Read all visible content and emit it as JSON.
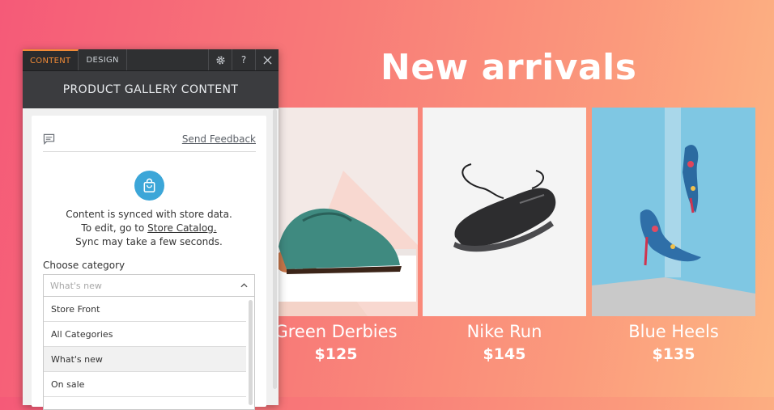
{
  "hero": {
    "title": "New arrivals"
  },
  "products": [
    {
      "name": "Green Derbies",
      "price": "$125"
    },
    {
      "name": "Nike Run",
      "price": "$145"
    },
    {
      "name": "Blue Heels",
      "price": "$135"
    }
  ],
  "panel": {
    "tabs": [
      {
        "label": "CONTENT"
      },
      {
        "label": "DESIGN"
      }
    ],
    "header_title": "PRODUCT GALLERY CONTENT",
    "feedback_link": "Send Feedback",
    "help_glyph": "?",
    "sync_line1": "Content is synced with store data.",
    "sync_line2_prefix": "To edit, go to ",
    "sync_line2_link": "Store Catalog.",
    "sync_line3": "Sync may take a few seconds.",
    "category_label": "Choose category",
    "category_placeholder": "What's new",
    "category_options": [
      "Store Front",
      "All Categories",
      "What's new",
      "On sale"
    ],
    "highlighted_option": "What's new"
  },
  "colors": {
    "accent_tab": "#f08a36",
    "sync_icon_bg": "#3ca6d8",
    "gradient_start": "#f55a78",
    "gradient_end": "#fdb784"
  }
}
